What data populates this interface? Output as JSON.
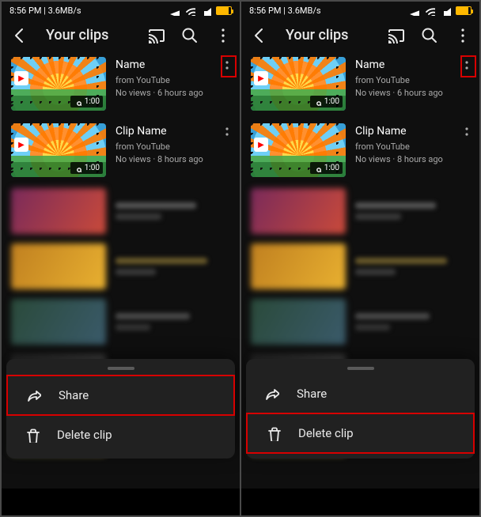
{
  "status": {
    "time_net": "8:56 PM | 3.6MB/s",
    "icons": [
      "airplane",
      "wifi",
      "mute",
      "battery"
    ]
  },
  "header": {
    "title": "Your clips"
  },
  "clips": [
    {
      "title": "Name",
      "source": "from YouTube",
      "stats": "No views · 6 hours ago",
      "duration": "1:00"
    },
    {
      "title": "Clip Name",
      "source": "from YouTube",
      "stats": "No views · 8 hours ago",
      "duration": "1:00"
    }
  ],
  "sheet": {
    "share": "Share",
    "delete": "Delete clip"
  },
  "left_highlight": "share",
  "right_highlight": "delete"
}
